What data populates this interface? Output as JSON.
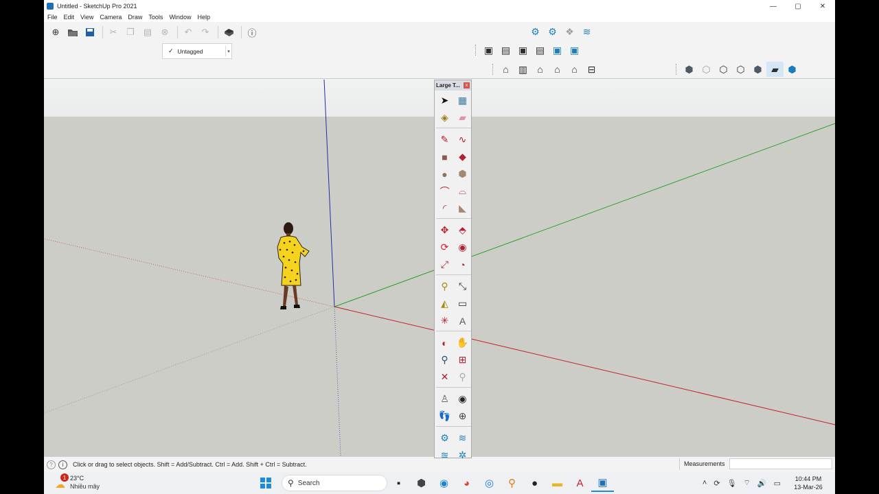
{
  "window": {
    "title": "Untitled - SketchUp Pro 2021",
    "minimize": "—",
    "maximize": "▢",
    "close": "✕"
  },
  "menu": [
    "File",
    "Edit",
    "View",
    "Camera",
    "Draw",
    "Tools",
    "Window",
    "Help"
  ],
  "toolbar": {
    "tag_selected": "Untagged",
    "tag_check": "✓",
    "buttons": [
      "new-file",
      "open-file",
      "save",
      "cut",
      "copy",
      "paste",
      "erase",
      "undo",
      "redo",
      "print",
      "model-info"
    ]
  },
  "large_toolset": {
    "title": "Large T...",
    "close": "x",
    "tools": [
      "select",
      "make-component",
      "paint-bucket",
      "eraser",
      "line",
      "freehand",
      "rectangle",
      "rotated-rectangle",
      "circle",
      "polygon",
      "arc",
      "2-point-arc",
      "3-point-arc",
      "pie",
      "move",
      "push-pull",
      "rotate",
      "follow-me",
      "scale",
      "offset",
      "tape-measure",
      "dimension",
      "protractor",
      "text",
      "axes",
      "3d-text",
      "orbit",
      "pan",
      "zoom",
      "zoom-window",
      "zoom-extents",
      "previous-view",
      "position-camera",
      "look-around",
      "walk",
      "section-plane",
      "warehouse",
      "extension-warehouse",
      "layout",
      "extension-manager"
    ]
  },
  "status": {
    "message": "Click or drag to select objects. Shift = Add/Subtract. Ctrl = Add. Shift + Ctrl = Subtract.",
    "measurements_label": "Measurements",
    "measurements_value": ""
  },
  "taskbar": {
    "weather_badge": "1",
    "temperature": "23°C",
    "condition": "Nhiều mây",
    "search_label": "Search",
    "time": "10:44 PM",
    "date": "13-Mar-26"
  },
  "colors": {
    "blue_axis": "#1f2d9c",
    "green_axis": "#2aa02a",
    "red_axis": "#c0202a",
    "accent": "#1a7dbd"
  }
}
